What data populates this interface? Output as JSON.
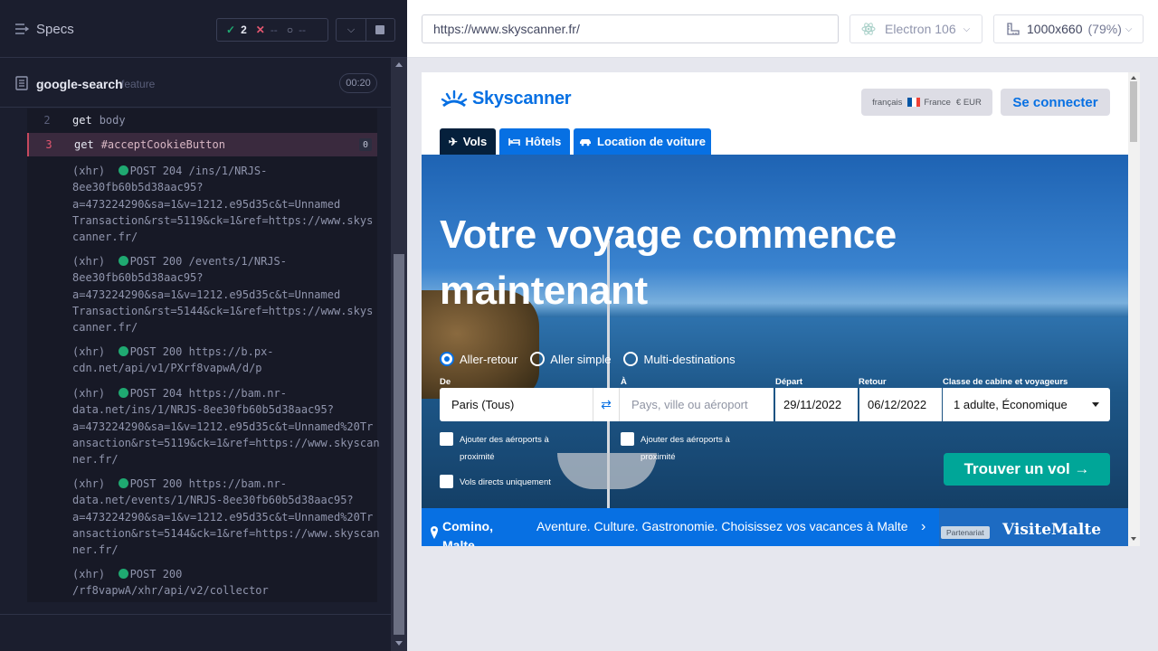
{
  "runner": {
    "specs_label": "Specs",
    "stats": {
      "passed": "2",
      "failed": "--",
      "pending": "--"
    },
    "spec_name": "google-search",
    "spec_sub": "feature",
    "duration": "00:20"
  },
  "commands": [
    {
      "num": "2",
      "name": "get",
      "arg": "body"
    },
    {
      "num": "3",
      "name": "get",
      "arg": "#acceptCookieButton",
      "count": "0"
    }
  ],
  "xhr_entries": [
    "(xhr)  ●POST 204 /ins/1/NRJS-\n8ee30fb60b5d38aac95?\na=473224290&sa=1&v=1212.e95d35c&t=Unnamed\nTransaction&rst=5119&ck=1&ref=https://www.skys\ncanner.fr/",
    "(xhr)  ●POST 200 /events/1/NRJS-\n8ee30fb60b5d38aac95?\na=473224290&sa=1&v=1212.e95d35c&t=Unnamed\nTransaction&rst=5144&ck=1&ref=https://www.skys\ncanner.fr/",
    "(xhr)  ●POST 200 https://b.px-\ncdn.net/api/v1/PXrf8vapwA/d/p",
    "(xhr)  ●POST 204 https://bam.nr-\ndata.net/ins/1/NRJS-8ee30fb60b5d38aac95?\na=473224290&sa=1&v=1212.e95d35c&t=Unnamed%20Tr\nansaction&rst=5119&ck=1&ref=https://www.skyscan\nner.fr/",
    "(xhr)  ●POST 200 https://bam.nr-\ndata.net/events/1/NRJS-8ee30fb60b5d38aac95?\na=473224290&sa=1&v=1212.e95d35c&t=Unnamed%20Tr\nansaction&rst=5144&ck=1&ref=https://www.skyscan\nner.fr/",
    "(xhr)  ●POST 200\n/rf8vapwA/xhr/api/v2/collector"
  ],
  "browser": {
    "url": "https://www.skyscanner.fr/",
    "engine": "Electron 106",
    "viewport": "1000x660",
    "zoom": "(79%)"
  },
  "site": {
    "logo": "Skyscanner",
    "locale": {
      "lang": "français",
      "country": "France",
      "currency": "€ EUR"
    },
    "login": "Se connecter",
    "tabs": [
      "Vols",
      "Hôtels",
      "Location de voiture"
    ],
    "hero_title": "Votre voyage commence maintenant",
    "trip_types": [
      "Aller-retour",
      "Aller simple",
      "Multi-destinations"
    ],
    "fields": {
      "from_label": "De",
      "from_value": "Paris (Tous)",
      "to_label": "À",
      "to_placeholder": "Pays, ville ou aéroport",
      "depart_label": "Départ",
      "depart_value": "29/11/2022",
      "return_label": "Retour",
      "return_value": "06/12/2022",
      "cabin_label": "Classe de cabine et voyageurs",
      "cabin_value": "1 adulte, Économique"
    },
    "nearby_from": "Ajouter des aéroports à proximité",
    "nearby_to": "Ajouter des aéroports à proximité",
    "direct_only": "Vols directs uniquement",
    "search_button": "Trouver un vol →",
    "banner": {
      "place": "Comino, Malte",
      "message": "Aventure. Culture. Gastronomie. Choisissez vos vacances à Malte",
      "partner": "Partenariat",
      "brand": "VisiteMalte"
    },
    "colors": {
      "brand": "#0770e3",
      "cta": "#00a698",
      "dark_tab": "#05203c"
    }
  },
  "icons": {
    "specs": "list-icon",
    "pass": "check-icon",
    "fail": "x-icon",
    "pending": "spinner-icon",
    "file": "file-icon",
    "browser": "electron-icon",
    "viewport": "ruler-icon",
    "flight": "plane-icon",
    "hotel": "bed-icon",
    "car": "car-icon",
    "swap": "swap-icon",
    "pin": "pin-icon"
  }
}
